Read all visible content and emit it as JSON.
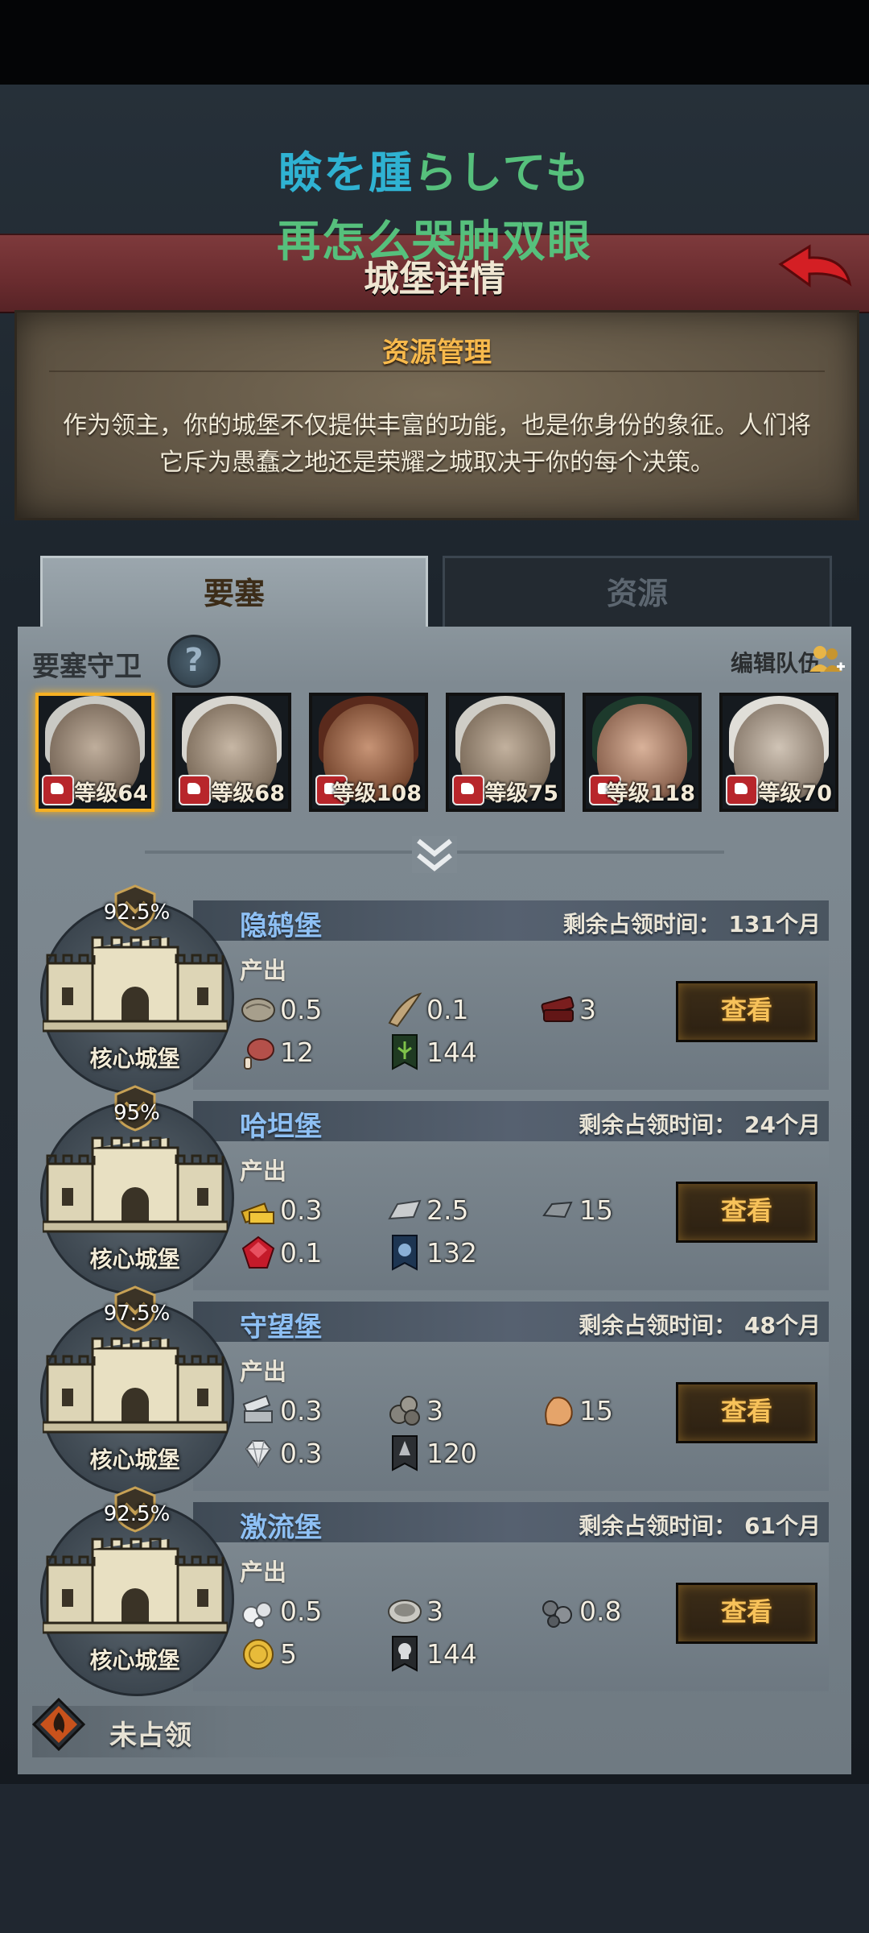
{
  "lyrics": {
    "line1_a": "瞼を",
    "line1_b": "腫",
    "line1_c": "らしても",
    "line2": "再怎么哭肿双眼"
  },
  "header": {
    "title": "城堡详情"
  },
  "intro": {
    "title": "资源管理",
    "description": "作为领主，你的城堡不仅提供丰富的功能，也是你身份的象征。人们将它斥为愚蠢之地还是荣耀之城取决于你的每个决策。"
  },
  "tabs": [
    {
      "label": "要塞",
      "active": true
    },
    {
      "label": "资源",
      "active": false
    }
  ],
  "guards": {
    "title": "要塞守卫",
    "help_icon": "?",
    "edit_label": "编辑队伍",
    "heroes": [
      {
        "level": "等级64",
        "selected": true
      },
      {
        "level": "等级68",
        "selected": false
      },
      {
        "level": "等级108",
        "selected": false
      },
      {
        "level": "等级75",
        "selected": false
      },
      {
        "level": "等级118",
        "selected": false
      },
      {
        "level": "等级70",
        "selected": false
      }
    ]
  },
  "castles": [
    {
      "name": "隐鸫堡",
      "percent": "92.5%",
      "core_label": "核心城堡",
      "remaining": "剩余占领时间： 131个月",
      "output_label": "产出",
      "resources": [
        {
          "icon": "stone-slab-icon",
          "value": "0.5"
        },
        {
          "icon": "horn-icon",
          "value": "0.1"
        },
        {
          "icon": "lumber-icon",
          "value": "3"
        },
        {
          "icon": "meat-icon",
          "value": "12"
        },
        {
          "icon": "banner-tree-icon",
          "value": "144"
        }
      ],
      "button": "查看"
    },
    {
      "name": "哈坦堡",
      "percent": "95%",
      "core_label": "核心城堡",
      "remaining": "剩余占领时间： 24个月",
      "output_label": "产出",
      "resources": [
        {
          "icon": "gold-bars-icon",
          "value": "0.3"
        },
        {
          "icon": "silver-ingot-icon",
          "value": "2.5"
        },
        {
          "icon": "iron-ingot-icon",
          "value": "15"
        },
        {
          "icon": "ruby-icon",
          "value": "0.1"
        },
        {
          "icon": "banner-blue-icon",
          "value": "132"
        }
      ],
      "button": "查看"
    },
    {
      "name": "守望堡",
      "percent": "97.5%",
      "core_label": "核心城堡",
      "remaining": "剩余占领时间： 48个月",
      "output_label": "产出",
      "resources": [
        {
          "icon": "steel-bars-icon",
          "value": "0.3"
        },
        {
          "icon": "stone-ore-icon",
          "value": "3"
        },
        {
          "icon": "copper-ore-icon",
          "value": "15"
        },
        {
          "icon": "diamond-icon",
          "value": "0.3"
        },
        {
          "icon": "banner-gray-icon",
          "value": "120"
        }
      ],
      "button": "查看"
    },
    {
      "name": "激流堡",
      "percent": "92.5%",
      "core_label": "核心城堡",
      "remaining": "剩余占领时间： 61个月",
      "output_label": "产出",
      "resources": [
        {
          "icon": "pearls-icon",
          "value": "0.5"
        },
        {
          "icon": "oyster-icon",
          "value": "3"
        },
        {
          "icon": "dark-pearls-icon",
          "value": "0.8"
        },
        {
          "icon": "gold-coin-icon",
          "value": "5"
        },
        {
          "icon": "banner-skull-icon",
          "value": "144"
        }
      ],
      "button": "查看"
    }
  ],
  "unoccupied": {
    "label": "未占领"
  },
  "colors": {
    "header_red": "#6a2c2f",
    "castle_name_blue": "#8ec0f4",
    "button_text_gold": "#f7c25a",
    "selected_gold": "#f6b023"
  }
}
